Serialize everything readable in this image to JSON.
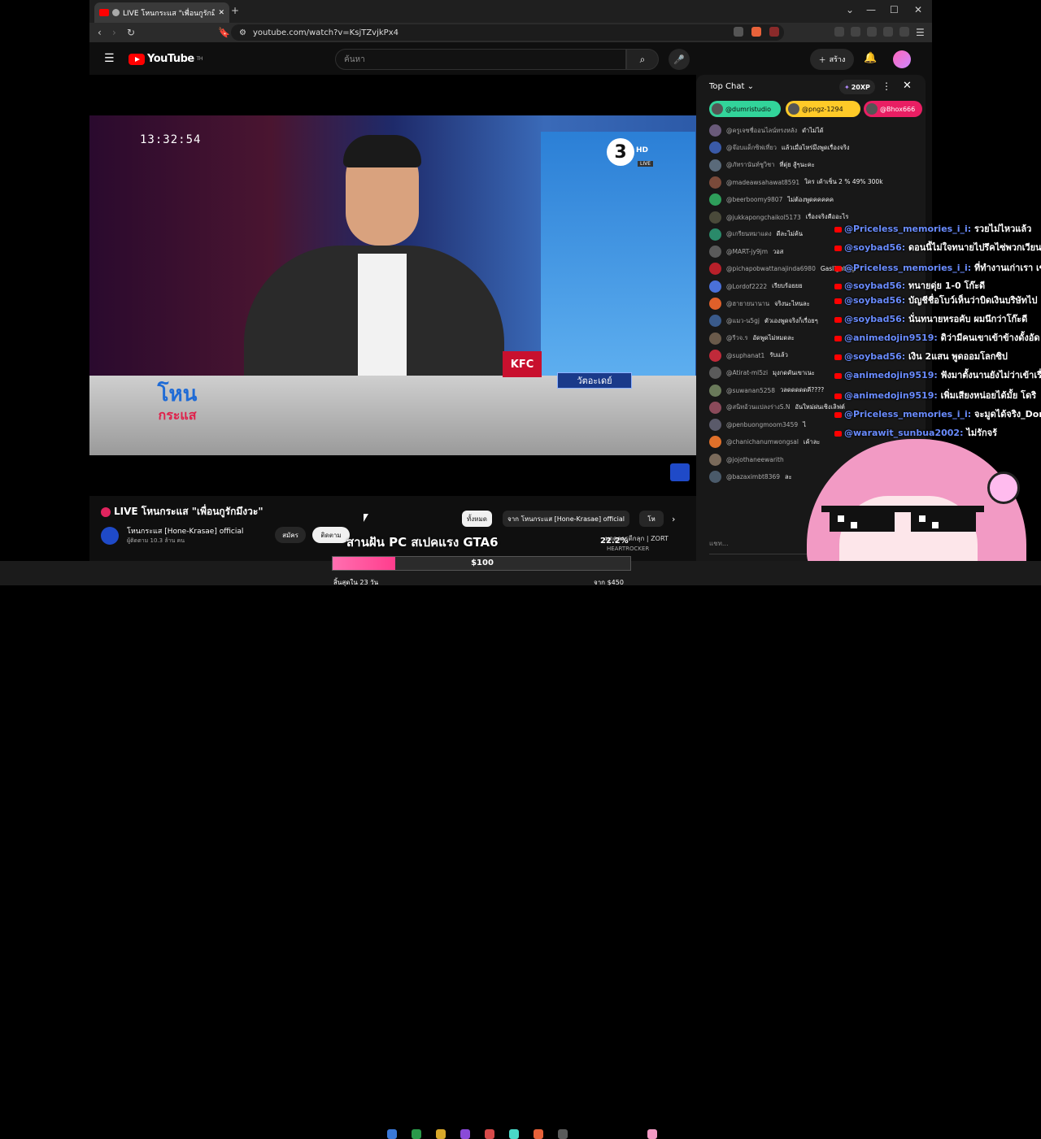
{
  "browser": {
    "tab_title": "LIVE โหนกระแส \"เพื่อนกูรักมึงวะ\"",
    "url": "youtube.com/watch?v=KsjTZvjkPx4",
    "new_tab": "+"
  },
  "youtube": {
    "logo_text": "YouTube",
    "logo_sup": "TH",
    "search_placeholder": "ค้นหา",
    "create_label": "สร้าง"
  },
  "video": {
    "timecode": "13:32:54",
    "channel_logo": "3",
    "channel_hd": "HD",
    "channel_live": "LIVE",
    "sponsor": "KFC",
    "lower_caption": "วัตอะเดย์",
    "show_logo_top": "โหน",
    "show_logo_bottom": "กระแส"
  },
  "info": {
    "title": "LIVE โหนกระแส \"เพื่อนกูรักมึงวะ\"",
    "channel": "โหนกระแส [Hone-Krasae] official",
    "subscribers": "ผู้ติดตาม 10.3 ล้าน คน",
    "join_label": "สมัคร",
    "subscribe_label": "ติดตาม"
  },
  "chips": [
    "ทั้งหมด",
    "จาก โหนกระแส [Hone-Krasae] official",
    "โห"
  ],
  "recommended": {
    "title": "มาดูการดีกลุก | ZORT",
    "channel": "HEARTROCKER"
  },
  "chat": {
    "title": "Top Chat",
    "xp": "20XP",
    "pinned": [
      {
        "name": "@dumristudio",
        "color": "#32d49a"
      },
      {
        "name": "@pngz-1294",
        "color": "#ffca28"
      },
      {
        "name": "@Bhox666",
        "color": "#e91e63"
      }
    ],
    "messages": [
      {
        "user": "@ครูเจซชื่ออนไลน์ทรงหลัง",
        "text": "ดำไม่ได้",
        "color": "#6a5a7a"
      },
      {
        "user": "@จ๊อบแด็กซิฟเที่ยว",
        "text": "แล้วเมื่อไหร่มึงพูดเรื่องจริง",
        "color": "#3a5aa8"
      },
      {
        "user": "@ภัทรานันท์ชูวิชา",
        "text": "ที่ดุ่ย สู้ๆนะคะ",
        "color": "#5a6a7a"
      },
      {
        "user": "@madeawsahawat8591",
        "text": "ใคร เค้าเซ็น 2 % 49% 300k",
        "color": "#7a4a3a"
      },
      {
        "user": "@beerboomy9807",
        "text": "ไม่ต้องพูดคคคคค",
        "color": "#2e9e5a"
      },
      {
        "user": "@jukkapongchaikol5173",
        "text": "เรื่องจริงคืออะไร",
        "color": "#4a4a3a"
      },
      {
        "user": "@เกรียนหมาแดง",
        "text": "ดีละไม่ค้น",
        "color": "#2a8a6a"
      },
      {
        "user": "@MART-jy9jm",
        "text": "วอส",
        "color": "#5a5a5a"
      },
      {
        "user": "@pichapobwattanajinda6980",
        "text": "Gaslighting",
        "color": "#b8202a"
      },
      {
        "user": "@Lordof2222",
        "text": "เรียบร้อยยย",
        "color": "#4a70d8"
      },
      {
        "user": "@ฮายายนานาน",
        "text": "จริงนะไหนละ",
        "color": "#e0602a"
      },
      {
        "user": "@แมว-น5gj",
        "text": "ตัวเองพูดจริงก็เรื่อยๆ",
        "color": "#3a5a8a"
      },
      {
        "user": "@รีวจ.ร",
        "text": "อัดพูดไม่หมดละ",
        "color": "#6a5a4a"
      },
      {
        "user": "@suphanat1",
        "text": "รับแล้ว",
        "color": "#c02a3a"
      },
      {
        "user": "@Atirat-ml5zi",
        "text": "มุงกดคันเขาเนะ",
        "color": "#5a5a5a"
      },
      {
        "user": "@suwanan5258",
        "text": "วลดดดดดคี????",
        "color": "#6a7a5a"
      },
      {
        "user": "@สนิทอ้วนแปลงร่างS.N",
        "text": "อันใหม่ฝนเชิงเลิฟต์",
        "color": "#8a4a5a"
      },
      {
        "user": "@penbuongmoom3459",
        "text": "ไ",
        "color": "#5a5a6a"
      },
      {
        "user": "@chanichanumwongsal",
        "text": "เค้าละ",
        "color": "#e0702a"
      },
      {
        "user": "@jojothaneewarith",
        "text": "",
        "color": "#7a6a5a"
      },
      {
        "user": "@bazaximbt8369",
        "text": "ละ",
        "color": "#4a5a6a"
      }
    ],
    "input_placeholder": "แชท..."
  },
  "overlay_chat": [
    {
      "user": "@Priceless_memories_i_i:",
      "text": "รวยไม่ไหวแล้ว"
    },
    {
      "user": "@soybad56:",
      "text": "ดอนนี้ไม่ใจทนายไปรึคไซ่พวกเวียน"
    },
    {
      "user": "@Priceless_memories_i_i:",
      "text": "ที่ทำงานเก่าเรา เขาออก เพราะเงินนั้นก็เป็นเงินเดือนเรา"
    },
    {
      "user": "@soybad56:",
      "text": "ทนายดุ่ย 1-0 โก๊ะดี"
    },
    {
      "user": "@soybad56:",
      "text": "บัญชีชื่อโบว์เห็นว่าบิดเงินบริษัทไป"
    },
    {
      "user": "@soybad56:",
      "text": "นั่นทนายหรอคับ ผมนึกว่าโก๊ะดี"
    },
    {
      "user": "@animedojin9519:",
      "text": "ดิว่ามีคนเขาเข้าข้างดั้งอัด"
    },
    {
      "user": "@soybad56:",
      "text": "เงิน 2แสน พูดออมโลกซิป"
    },
    {
      "user": "@animedojin9519:",
      "text": "ฟังมาตั้งนานยังไม่ว่าเข้าเรื่อง"
    },
    {
      "user": "@animedojin9519:",
      "text": "เพิ่มเสียงหน่อยได้มั้ย โดริ"
    },
    {
      "user": "@Priceless_memories_i_i:",
      "text": "จะมูดได้จริง_Dora"
    },
    {
      "user": "@warawit_sunbua2002:",
      "text": "ไม่รักจร้"
    }
  ],
  "stream_overlay": {
    "game_text": "สานฝัน PC สเปคแรง GTA6",
    "percent": "22.2%",
    "goal_amount": "$100",
    "goal_progress": 0.21,
    "days_left": "สิ้นสุดใน 23 วัน",
    "from": "จาก $450"
  }
}
